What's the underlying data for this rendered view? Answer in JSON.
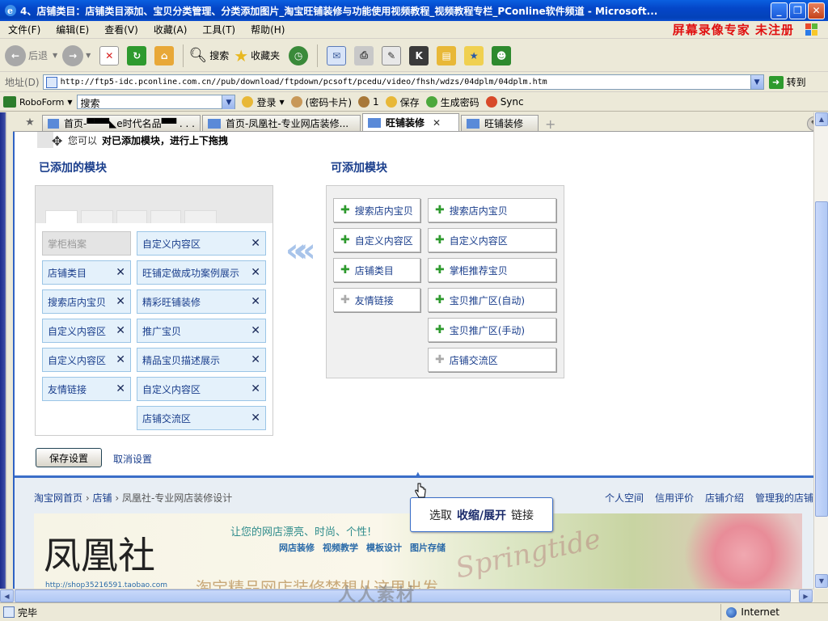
{
  "window": {
    "title": "4、店铺类目：店铺类目添加、宝贝分类管理、分类添加图片_淘宝旺铺装修与功能使用视频教程_视频教程专栏_PConline软件频道 - Microsoft...",
    "minimize": "_",
    "maximize": "❐",
    "close": "✕"
  },
  "menubar": {
    "items": [
      "文件(F)",
      "编辑(E)",
      "查看(V)",
      "收藏(A)",
      "工具(T)",
      "帮助(H)"
    ],
    "recorder_text": "屏幕录像专家 未注册"
  },
  "toolbar": {
    "back": "后退",
    "search": "搜索",
    "favorites": "收藏夹"
  },
  "address": {
    "label": "地址(D)",
    "url": "http://ftp5-idc.pconline.com.cn//pub/download/ftpdown/pcsoft/pcedu/video/fhsh/wdzs/04dplm/04dplm.htm",
    "go": "转到"
  },
  "roboform": {
    "brand": "RoboForm",
    "search_value": "搜索",
    "login": "登录",
    "passcards": "(密码卡片)",
    "identity_count": "1",
    "save": "保存",
    "generate": "生成密码",
    "sync": "Sync"
  },
  "tabs": [
    {
      "label": "首页-▀▀▀◣e时代名品▀▀ . . ."
    },
    {
      "label": "首页-凤凰社-专业网店装修..."
    },
    {
      "label": "旺铺装修",
      "active": true
    },
    {
      "label": "旺铺装修"
    }
  ],
  "page": {
    "hint_prefix": "您可以",
    "hint_bold": "对已添加模块，进行上下拖拽",
    "added_title": "已添加的模块",
    "available_title": "可添加模块",
    "added_left": [
      {
        "label": "掌柜档案",
        "removable": false
      },
      {
        "label": "店铺类目",
        "removable": true
      },
      {
        "label": "搜索店内宝贝",
        "removable": true
      },
      {
        "label": "自定义内容区",
        "removable": true
      },
      {
        "label": "自定义内容区",
        "removable": true
      },
      {
        "label": "友情链接",
        "removable": true
      }
    ],
    "added_right": [
      {
        "label": "自定义内容区"
      },
      {
        "label": "旺铺定做成功案例展示"
      },
      {
        "label": "精彩旺铺装修"
      },
      {
        "label": "推广宝贝"
      },
      {
        "label": "精品宝贝描述展示"
      },
      {
        "label": "自定义内容区"
      },
      {
        "label": "店铺交流区"
      }
    ],
    "remove_symbol": "✕",
    "transfer_arrows": "«",
    "available_left": [
      {
        "label": "搜索店内宝贝",
        "enabled": true
      },
      {
        "label": "自定义内容区",
        "enabled": true
      },
      {
        "label": "店铺类目",
        "enabled": true
      },
      {
        "label": "友情链接",
        "enabled": false
      }
    ],
    "available_right": [
      {
        "label": "搜索店内宝贝",
        "enabled": true
      },
      {
        "label": "自定义内容区",
        "enabled": true
      },
      {
        "label": "掌柜推荐宝贝",
        "enabled": true
      },
      {
        "label": "宝贝推广区(自动)",
        "enabled": true
      },
      {
        "label": "宝贝推广区(手动)",
        "enabled": true
      },
      {
        "label": "店铺交流区",
        "enabled": false
      }
    ],
    "plus_symbol": "✚",
    "save_button": "保存设置",
    "cancel_link": "取消设置"
  },
  "shop": {
    "breadcrumb": [
      "淘宝网首页",
      "店铺",
      "凤凰社-专业网店装修设计"
    ],
    "breadcrumb_sep": "›",
    "top_links": [
      "个人空间",
      "信用评价",
      "店铺介绍",
      "管理我的店铺"
    ],
    "shop_name": "凤凰社",
    "slogan": "让您的网店漂亮、时尚、个性!",
    "banner_nav": [
      "网店装修",
      "视频教学",
      "模板设计",
      "图片存储"
    ],
    "shop_url": "http://shop35216591.taobao.com",
    "big_slogan": "淘宝精品网店装修梦想从这里出发"
  },
  "tooltip": {
    "prefix": "选取",
    "bold": "收缩/展开",
    "suffix": "链接"
  },
  "status": {
    "text": "完毕",
    "zone": "Internet"
  },
  "watermark": "人人素材",
  "colors": {
    "titlebar": "#0446C8",
    "recorder_text": "#E01010",
    "module_blue": "#E4F1FB",
    "link_blue": "#1A3E8C"
  }
}
